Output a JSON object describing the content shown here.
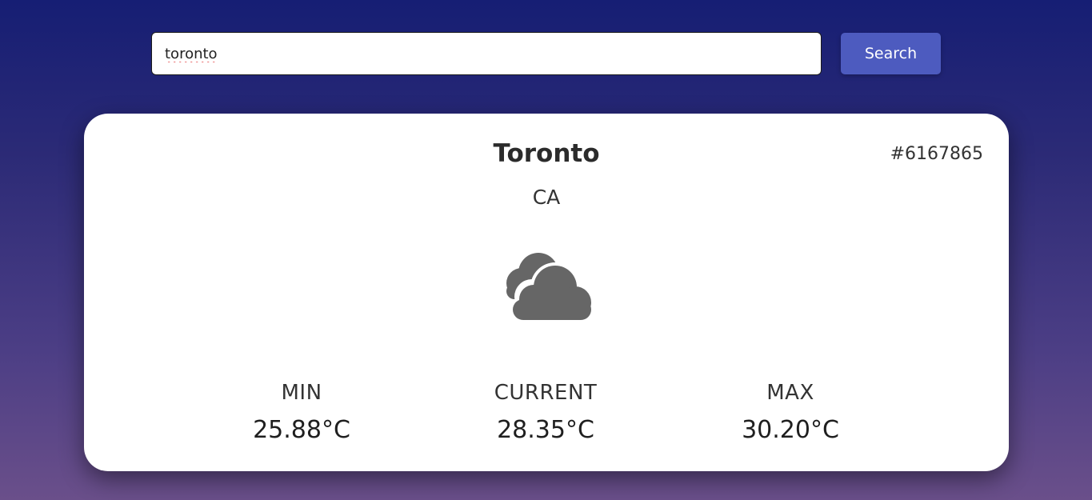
{
  "search": {
    "value": "toronto",
    "button_label": "Search"
  },
  "weather": {
    "city": "Toronto",
    "city_id": "#6167865",
    "country": "CA",
    "icon": "cloud-icon",
    "min_label": "MIN",
    "min_value": "25.88°C",
    "current_label": "CURRENT",
    "current_value": "28.35°C",
    "max_label": "MAX",
    "max_value": "30.20°C"
  },
  "colors": {
    "accent": "#4d5bbf",
    "icon": "#666666",
    "background_top": "#161e74",
    "background_bottom": "#6a4f8a"
  }
}
